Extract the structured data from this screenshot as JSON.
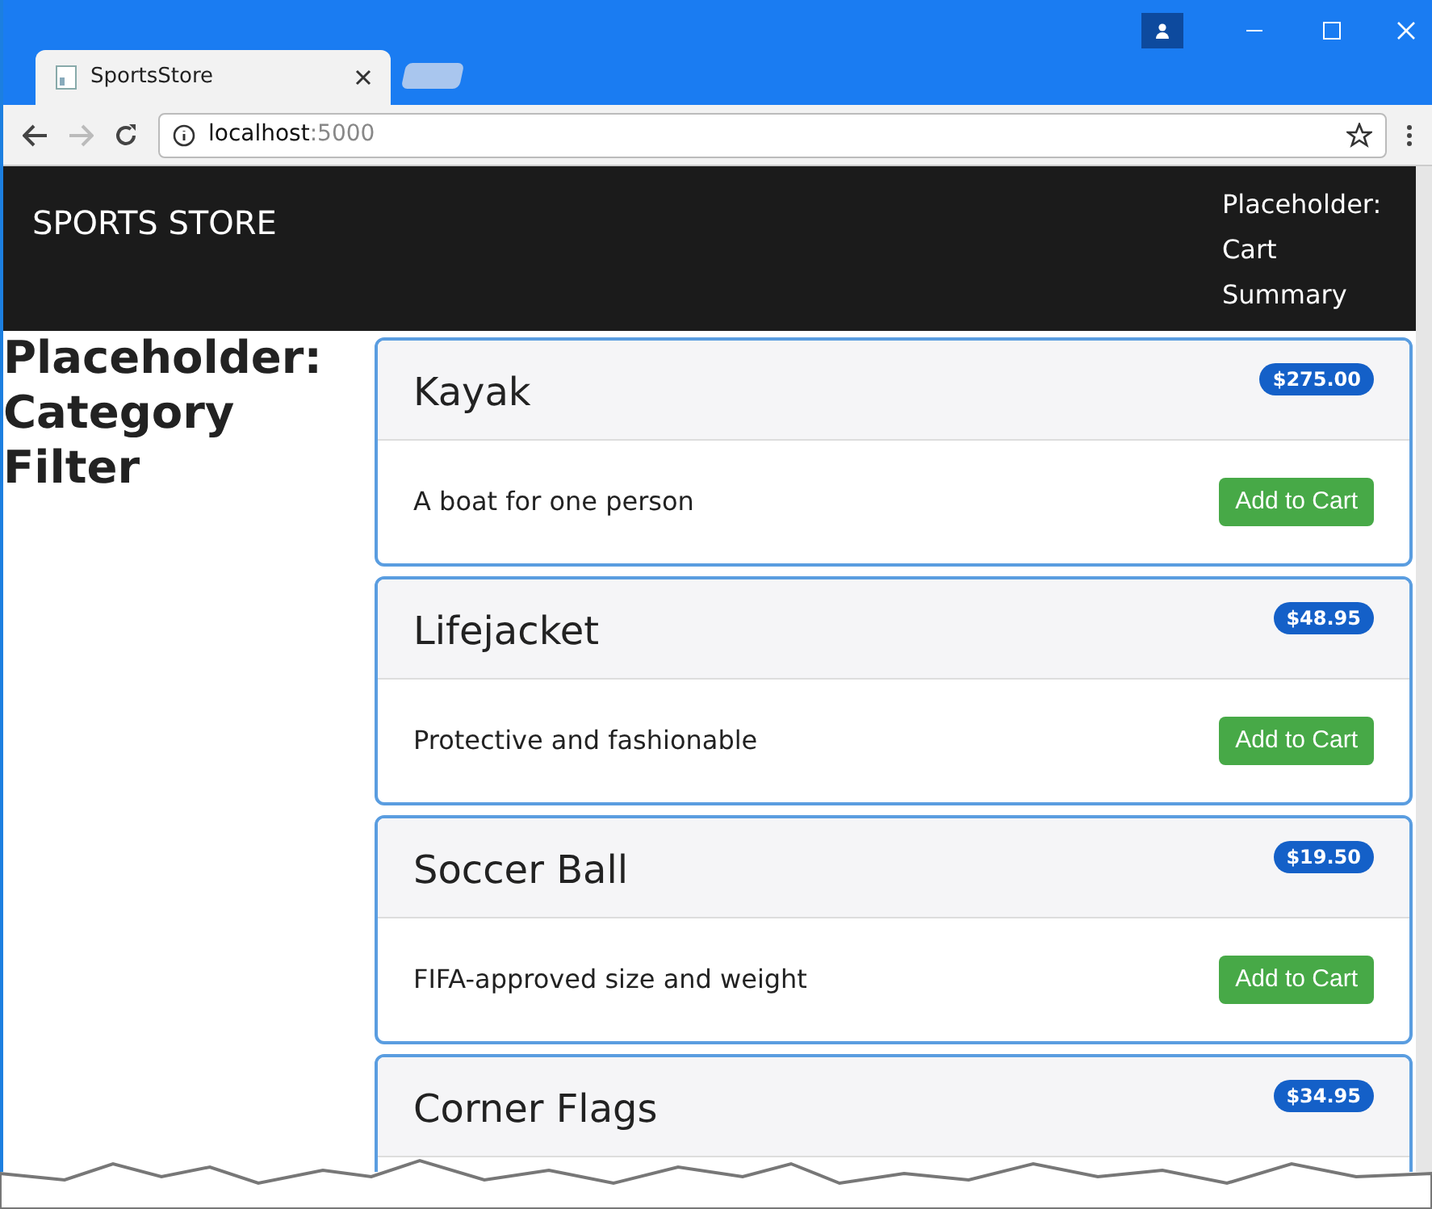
{
  "browser": {
    "tab_title": "SportsStore",
    "address_host": "localhost",
    "address_port": ":5000"
  },
  "navbar": {
    "brand": "SPORTS STORE",
    "cart_summary": "Placeholder: Cart Summary"
  },
  "sidebar": {
    "heading": "Placeholder: Category Filter"
  },
  "products": [
    {
      "name": "Kayak",
      "price": "$275.00",
      "description": "A boat for one person",
      "button": "Add to Cart"
    },
    {
      "name": "Lifejacket",
      "price": "$48.95",
      "description": "Protective and fashionable",
      "button": "Add to Cart"
    },
    {
      "name": "Soccer Ball",
      "price": "$19.50",
      "description": "FIFA-approved size and weight",
      "button": "Add to Cart"
    },
    {
      "name": "Corner Flags",
      "price": "$34.95"
    }
  ]
}
